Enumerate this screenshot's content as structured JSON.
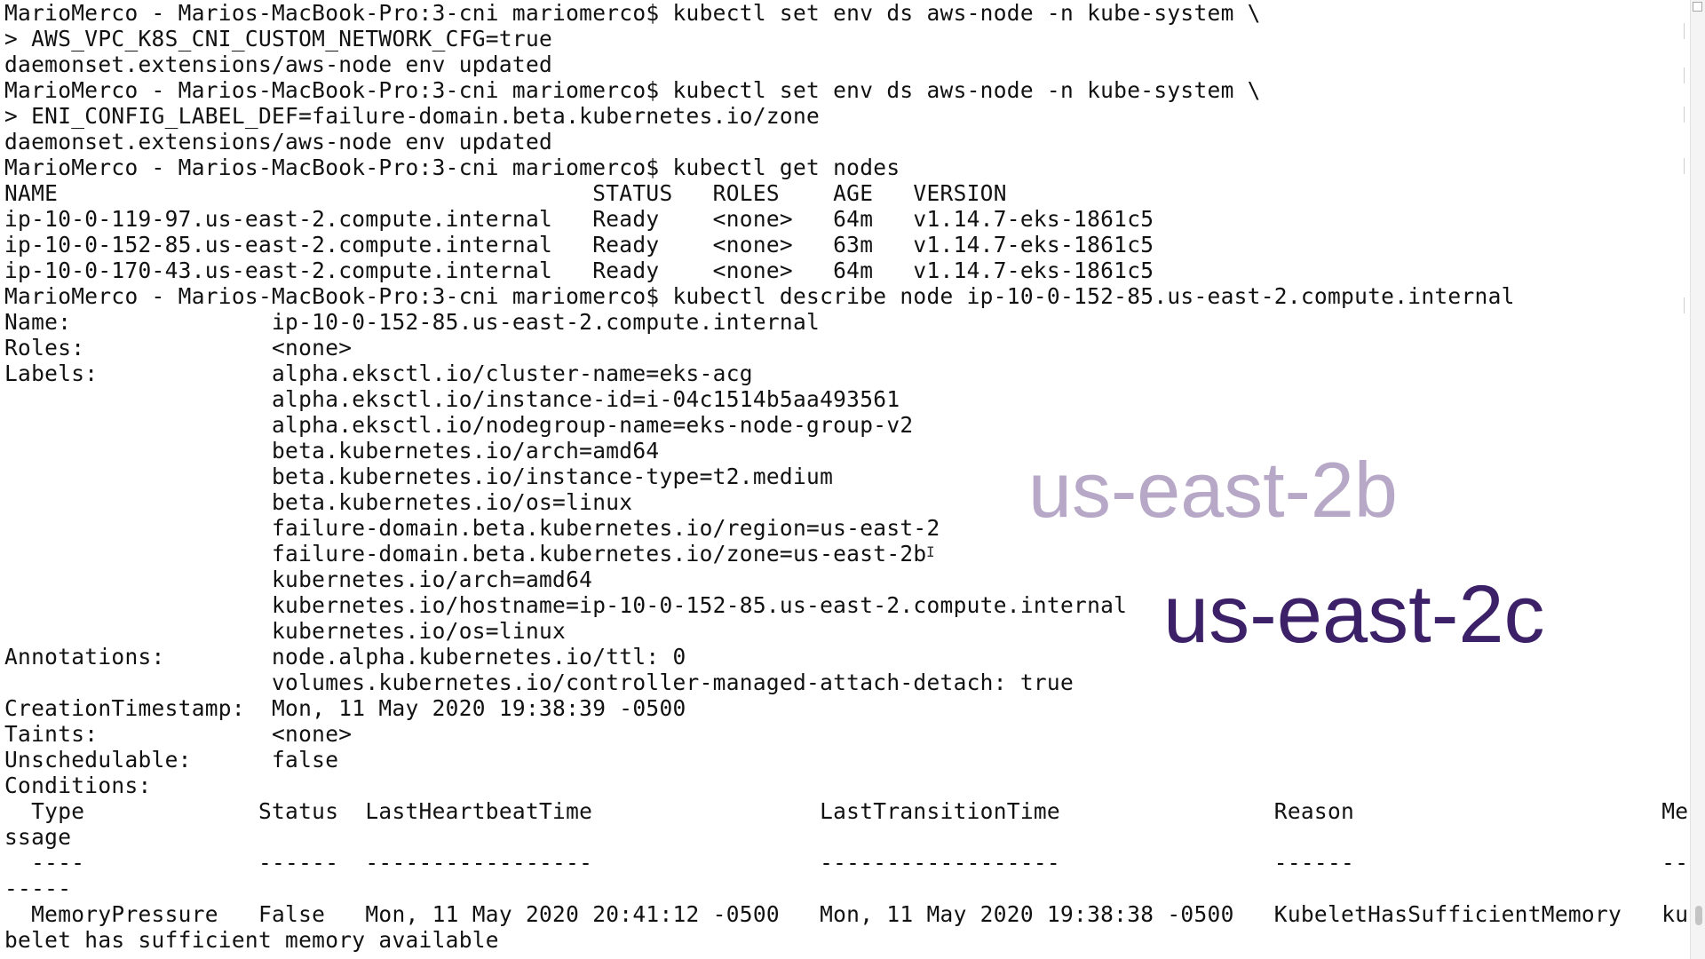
{
  "terminal": {
    "lines": [
      "MarioMerco - Marios-MacBook-Pro:3-cni mariomerco$ kubectl set env ds aws-node -n kube-system \\",
      "> AWS_VPC_K8S_CNI_CUSTOM_NETWORK_CFG=true",
      "daemonset.extensions/aws-node env updated",
      "MarioMerco - Marios-MacBook-Pro:3-cni mariomerco$ kubectl set env ds aws-node -n kube-system \\",
      "> ENI_CONFIG_LABEL_DEF=failure-domain.beta.kubernetes.io/zone",
      "daemonset.extensions/aws-node env updated",
      "MarioMerco - Marios-MacBook-Pro:3-cni mariomerco$ kubectl get nodes",
      "NAME                                        STATUS   ROLES    AGE   VERSION",
      "ip-10-0-119-97.us-east-2.compute.internal   Ready    <none>   64m   v1.14.7-eks-1861c5",
      "ip-10-0-152-85.us-east-2.compute.internal   Ready    <none>   63m   v1.14.7-eks-1861c5",
      "ip-10-0-170-43.us-east-2.compute.internal   Ready    <none>   64m   v1.14.7-eks-1861c5",
      "MarioMerco - Marios-MacBook-Pro:3-cni mariomerco$ kubectl describe node ip-10-0-152-85.us-east-2.compute.internal",
      "Name:               ip-10-0-152-85.us-east-2.compute.internal",
      "Roles:              <none>",
      "Labels:             alpha.eksctl.io/cluster-name=eks-acg",
      "                    alpha.eksctl.io/instance-id=i-04c1514b5aa493561",
      "                    alpha.eksctl.io/nodegroup-name=eks-node-group-v2",
      "                    beta.kubernetes.io/arch=amd64",
      "                    beta.kubernetes.io/instance-type=t2.medium",
      "                    beta.kubernetes.io/os=linux",
      "                    failure-domain.beta.kubernetes.io/region=us-east-2",
      "                    failure-domain.beta.kubernetes.io/zone=us-east-2b",
      "                    kubernetes.io/arch=amd64",
      "                    kubernetes.io/hostname=ip-10-0-152-85.us-east-2.compute.internal",
      "                    kubernetes.io/os=linux",
      "Annotations:        node.alpha.kubernetes.io/ttl: 0",
      "                    volumes.kubernetes.io/controller-managed-attach-detach: true",
      "CreationTimestamp:  Mon, 11 May 2020 19:38:39 -0500",
      "Taints:             <none>",
      "Unschedulable:      false",
      "Conditions:",
      "  Type             Status  LastHeartbeatTime                 LastTransitionTime                Reason                       Me",
      "ssage",
      "  ----             ------  -----------------                 ------------------                ------                       --",
      "-----",
      "  MemoryPressure   False   Mon, 11 May 2020 20:41:12 -0500   Mon, 11 May 2020 19:38:38 -0500   KubeletHasSufficientMemory   ku",
      "belet has sufficient memory available"
    ]
  },
  "overlays": {
    "zone_b": "us-east-2b",
    "zone_c": "us-east-2c"
  },
  "colors": {
    "zone_b": "#b6a8c6",
    "zone_c": "#3d2168",
    "text": "#111111",
    "background": "#ffffff"
  }
}
